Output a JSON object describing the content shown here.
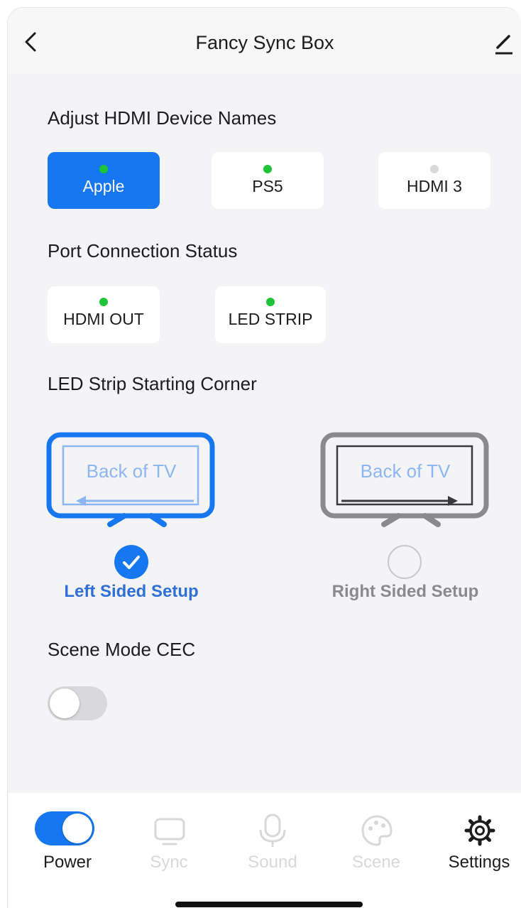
{
  "header": {
    "title": "Fancy Sync Box",
    "back_icon": "chevron-left-icon",
    "edit_icon": "pencil-icon"
  },
  "hdmi_names": {
    "title": "Adjust HDMI Device Names",
    "devices": [
      {
        "label": "Apple",
        "status_color": "#1fc43a",
        "selected": true
      },
      {
        "label": "PS5",
        "status_color": "#1fc43a",
        "selected": false
      },
      {
        "label": "HDMI 3",
        "status_color": "#d9d9d9",
        "selected": false
      }
    ]
  },
  "port_status": {
    "title": "Port Connection Status",
    "ports": [
      {
        "label": "HDMI OUT",
        "status_color": "#1fc43a"
      },
      {
        "label": "LED STRIP",
        "status_color": "#1fc43a"
      }
    ]
  },
  "led_corner": {
    "title": "LED Strip Starting Corner",
    "options": [
      {
        "tv_text": "Back of TV",
        "label": "Left Sided Setup",
        "selected": true
      },
      {
        "tv_text": "Back of TV",
        "label": "Right Sided Setup",
        "selected": false
      }
    ]
  },
  "scene_mode": {
    "title": "Scene Mode CEC",
    "enabled": false
  },
  "tabbar": {
    "power": {
      "label": "Power",
      "on": true
    },
    "sync": {
      "label": "Sync",
      "icon": "tv-icon"
    },
    "sound": {
      "label": "Sound",
      "icon": "microphone-icon"
    },
    "scene": {
      "label": "Scene",
      "icon": "palette-icon"
    },
    "settings": {
      "label": "Settings",
      "icon": "gear-icon"
    }
  },
  "colors": {
    "accent": "#1677f0",
    "active_dot": "#1fc43a",
    "inactive_dot": "#d9d9d9",
    "selected_text": "#2f6fd6",
    "unselected_text": "#8a8a8e"
  }
}
